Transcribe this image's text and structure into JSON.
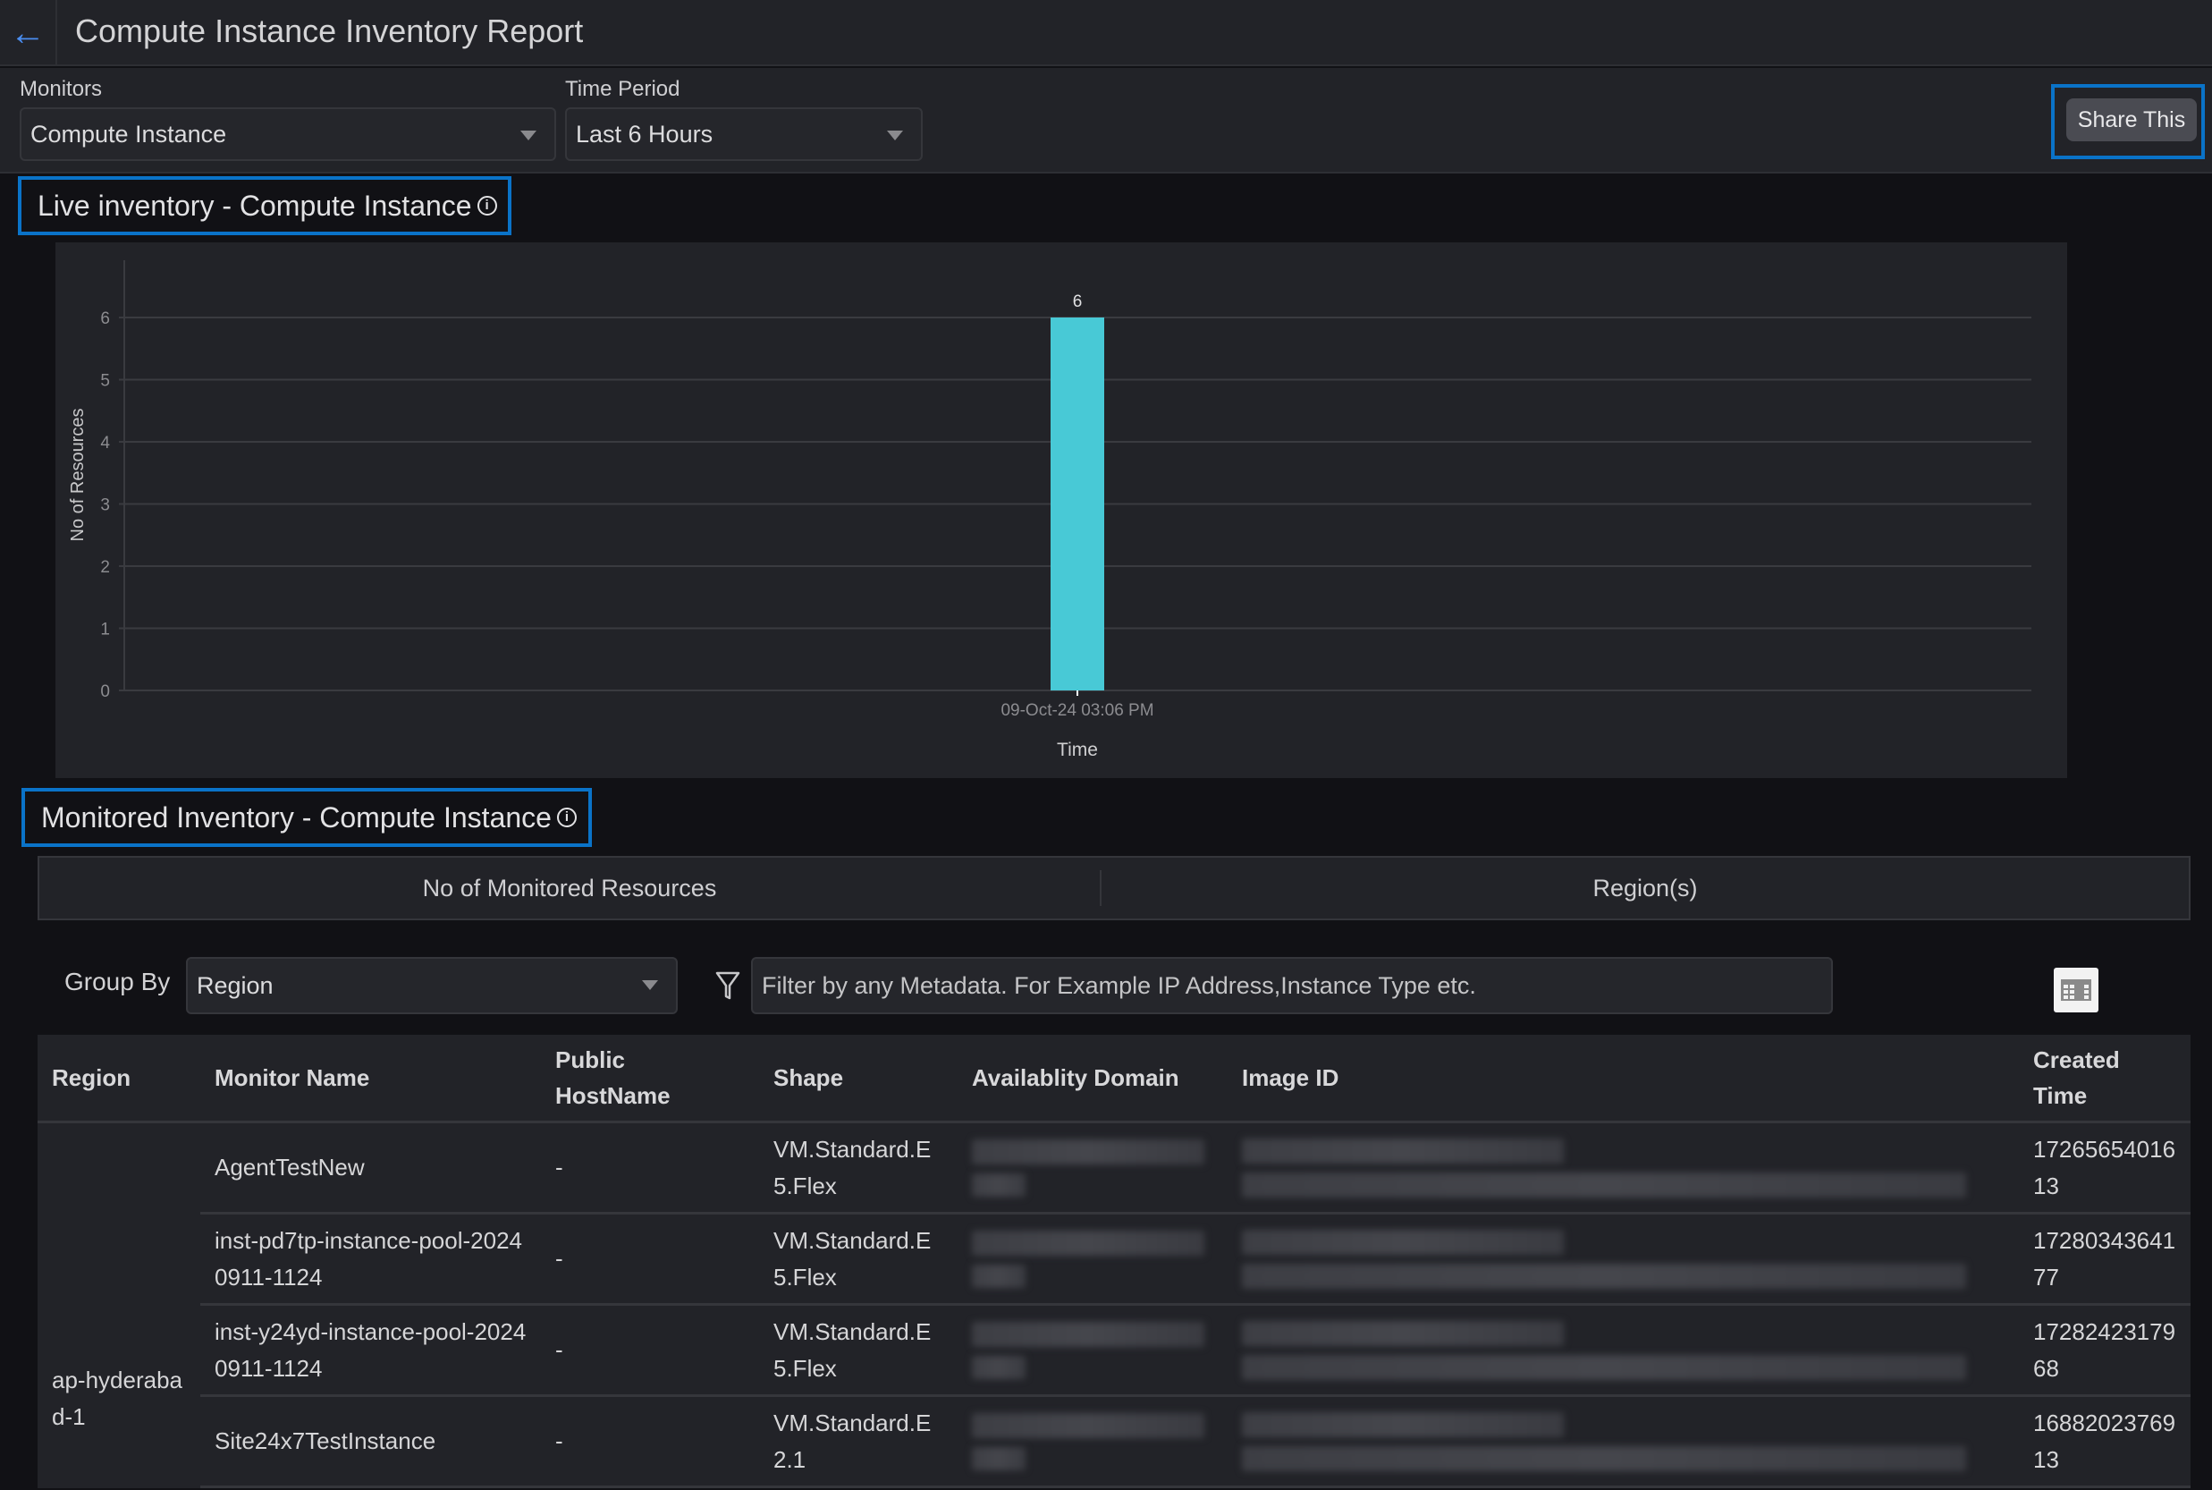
{
  "header": {
    "title": "Compute Instance Inventory Report",
    "back_icon": "arrow-left-icon"
  },
  "filters": {
    "monitors_label": "Monitors",
    "monitors_value": "Compute Instance",
    "time_period_label": "Time Period",
    "time_period_value": "Last 6 Hours",
    "share_label": "Share This"
  },
  "live_section": {
    "title": "Live inventory - Compute Instance",
    "info_icon": "i"
  },
  "chart_data": {
    "type": "bar",
    "categories": [
      "09-Oct-24 03:06 PM"
    ],
    "values": [
      6
    ],
    "data_labels": [
      "6"
    ],
    "title": "",
    "xlabel": "Time",
    "ylabel": "No of Resources",
    "ylim": [
      0,
      7
    ],
    "yticks": [
      "0",
      "1",
      "2",
      "3",
      "4",
      "5",
      "6"
    ],
    "grid": true,
    "bar_color": "#48c9d6",
    "legend": "none"
  },
  "monitored_section": {
    "title": "Monitored Inventory - Compute Instance",
    "info_icon": "i",
    "summary": {
      "col1": "No of Monitored Resources",
      "col2": "Region(s)"
    },
    "group_by_label": "Group By",
    "group_by_value": "Region",
    "filter_placeholder": "Filter by any Metadata. For Example IP Address,Instance Type etc.",
    "filter_icon": "funnel-icon",
    "column_settings_icon": "table-columns-icon"
  },
  "table": {
    "headers": [
      "Region",
      "Monitor Name",
      "Public HostName",
      "Shape",
      "Availablity Domain",
      "Image ID",
      "Created Time"
    ],
    "region": "ap-hyderabad-1",
    "rows": [
      {
        "monitor_name": "AgentTestNew",
        "public_hostname": "-",
        "shape": "VM.Standard.E5.Flex",
        "availability_domain": "[redacted]",
        "image_id": "[redacted]",
        "created_time": "1726565401613"
      },
      {
        "monitor_name": "inst-pd7tp-instance-pool-20240911-1124",
        "public_hostname": "-",
        "shape": "VM.Standard.E5.Flex",
        "availability_domain": "[redacted]",
        "image_id": "[redacted]",
        "created_time": "1728034364177"
      },
      {
        "monitor_name": "inst-y24yd-instance-pool-20240911-1124",
        "public_hostname": "-",
        "shape": "VM.Standard.E5.Flex",
        "availability_domain": "[redacted]",
        "image_id": "[redacted]",
        "created_time": "1728242317968"
      },
      {
        "monitor_name": "Site24x7TestInstance",
        "public_hostname": "-",
        "shape": "VM.Standard.E2.1",
        "availability_domain": "[redacted]",
        "image_id": "[redacted]",
        "created_time": "1688202376913"
      }
    ]
  }
}
